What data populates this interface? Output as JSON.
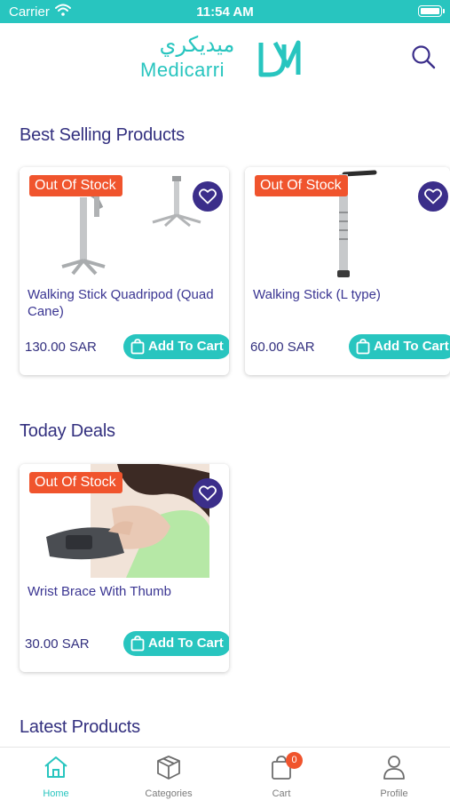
{
  "status_bar": {
    "carrier": "Carrier",
    "time": "11:54 AM"
  },
  "header": {
    "logo_arabic": "ميديكري",
    "logo_latin": "Medicarri",
    "search_icon": "search-icon"
  },
  "sections": {
    "best_selling": "Best Selling Products",
    "today_deals": "Today Deals",
    "latest": "Latest Products"
  },
  "products": [
    {
      "badge": "Out Of Stock",
      "name": "Walking Stick Quadripod (Quad Cane)",
      "price": "130.00 SAR",
      "cta": "Add To Cart"
    },
    {
      "badge": "Out Of Stock",
      "name": "Walking Stick (L type)",
      "price": "60.00 SAR",
      "cta": "Add To Cart"
    }
  ],
  "deals": [
    {
      "badge": "Out Of Stock",
      "name": "Wrist Brace With Thumb",
      "price": "30.00 SAR",
      "cta": "Add To Cart"
    }
  ],
  "tabbar": {
    "items": [
      {
        "label": "Home",
        "icon": "home-icon"
      },
      {
        "label": "Categories",
        "icon": "box-icon"
      },
      {
        "label": "Cart",
        "icon": "cart-icon"
      },
      {
        "label": "Profile",
        "icon": "user-icon"
      }
    ],
    "active": "Home",
    "cart_count": "0"
  },
  "colors": {
    "brand_teal": "#28c5bf",
    "brand_purple": "#3b2e8a",
    "badge_orange": "#f0542d"
  }
}
